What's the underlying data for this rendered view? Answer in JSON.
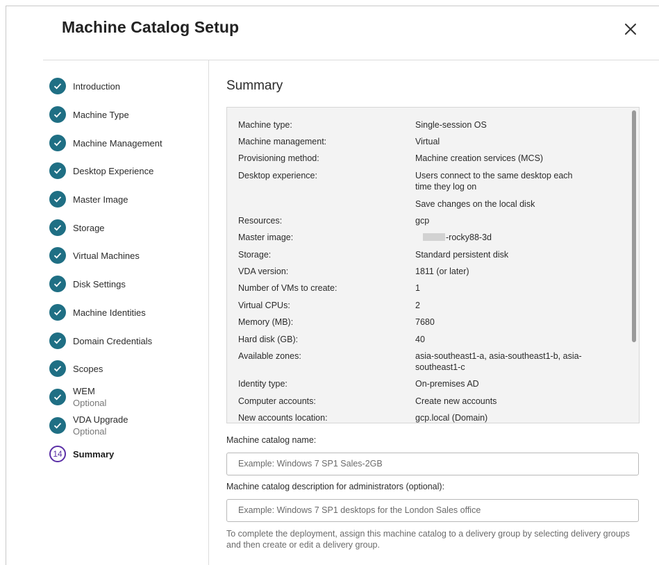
{
  "dialog": {
    "title": "Machine Catalog Setup"
  },
  "steps": [
    {
      "label": "Introduction",
      "state": "done"
    },
    {
      "label": "Machine Type",
      "state": "done"
    },
    {
      "label": "Machine Management",
      "state": "done"
    },
    {
      "label": "Desktop Experience",
      "state": "done"
    },
    {
      "label": "Master Image",
      "state": "done"
    },
    {
      "label": "Storage",
      "state": "done"
    },
    {
      "label": "Virtual Machines",
      "state": "done"
    },
    {
      "label": "Disk Settings",
      "state": "done"
    },
    {
      "label": "Machine Identities",
      "state": "done"
    },
    {
      "label": "Domain Credentials",
      "state": "done"
    },
    {
      "label": "Scopes",
      "state": "done"
    },
    {
      "label": "WEM",
      "sub": "Optional",
      "state": "done"
    },
    {
      "label": "VDA Upgrade",
      "sub": "Optional",
      "state": "done"
    },
    {
      "label": "Summary",
      "number": "14",
      "state": "current"
    }
  ],
  "summary": {
    "heading": "Summary",
    "rows": [
      {
        "key": "Machine type:",
        "value": "Single-session OS"
      },
      {
        "key": "Machine management:",
        "value": "Virtual"
      },
      {
        "key": "Provisioning method:",
        "value": "Machine creation services (MCS)"
      },
      {
        "key": "Desktop experience:",
        "value": "Users connect to the same desktop each time they log on"
      },
      {
        "key": "",
        "value": "Save changes on the local disk"
      },
      {
        "key": "Resources:",
        "value": "gcp"
      },
      {
        "key": "Master image:",
        "value": "-rocky88-3d"
      },
      {
        "key": "Storage:",
        "value": "Standard persistent disk"
      },
      {
        "key": "VDA version:",
        "value": "1811 (or later)"
      },
      {
        "key": "Number of VMs to create:",
        "value": "1"
      },
      {
        "key": "Virtual CPUs:",
        "value": "2"
      },
      {
        "key": "Memory (MB):",
        "value": "7680"
      },
      {
        "key": "Hard disk (GB):",
        "value": "40"
      },
      {
        "key": "Available zones:",
        "value": "asia-southeast1-a, asia-southeast1-b, asia-southeast1-c"
      },
      {
        "key": "Identity type:",
        "value": "On-premises AD"
      },
      {
        "key": "Computer accounts:",
        "value": "Create new accounts"
      },
      {
        "key": "New accounts location:",
        "value": "gcp.local (Domain)"
      }
    ]
  },
  "form": {
    "name_label": "Machine catalog name:",
    "name_placeholder": "Example: Windows 7 SP1 Sales-2GB",
    "name_value": "",
    "desc_label": "Machine catalog description for administrators (optional):",
    "desc_placeholder": "Example: Windows 7 SP1 desktops for the London Sales office",
    "desc_value": "",
    "hint": "To complete the deployment, assign this machine catalog to a delivery group by selecting delivery groups and then create or edit a delivery group."
  },
  "icons": {
    "close": "close-icon",
    "step_done": "check-icon",
    "accent": "#1f6f84",
    "current": "#5a2ea6"
  }
}
